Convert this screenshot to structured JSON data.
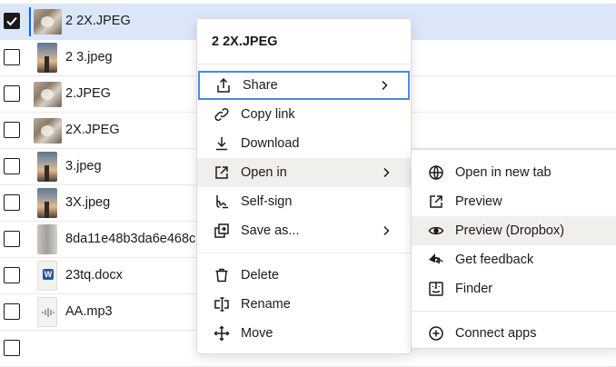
{
  "files": [
    {
      "name": "2 2X.JPEG",
      "thumb": "dog",
      "checked": true,
      "selected": true
    },
    {
      "name": "2 3.jpeg",
      "thumb": "sky",
      "checked": false,
      "selected": false
    },
    {
      "name": "2.JPEG",
      "thumb": "dog",
      "checked": false,
      "selected": false
    },
    {
      "name": "2X.JPEG",
      "thumb": "dog",
      "checked": false,
      "selected": false
    },
    {
      "name": "3.jpeg",
      "thumb": "sky",
      "checked": false,
      "selected": false
    },
    {
      "name": "3X.jpeg",
      "thumb": "sky",
      "checked": false,
      "selected": false
    },
    {
      "name": "8da11e48b3da6e468c",
      "thumb": "gray",
      "checked": false,
      "selected": false
    },
    {
      "name": "23tq.docx",
      "thumb": "doc",
      "checked": false,
      "selected": false
    },
    {
      "name": "AA.mp3",
      "thumb": "audio",
      "checked": false,
      "selected": false
    }
  ],
  "context_menu": {
    "title": "2 2X.JPEG",
    "items": [
      {
        "label": "Share",
        "icon": "share-icon",
        "submenu": true
      },
      {
        "label": "Copy link",
        "icon": "link-icon",
        "submenu": false
      },
      {
        "label": "Download",
        "icon": "download-icon",
        "submenu": false
      },
      {
        "label": "Open in",
        "icon": "open-external-icon",
        "submenu": true
      },
      {
        "label": "Self-sign",
        "icon": "signature-icon",
        "submenu": false
      },
      {
        "label": "Save as...",
        "icon": "save-as-icon",
        "submenu": true
      },
      {
        "label": "Delete",
        "icon": "trash-icon",
        "submenu": false
      },
      {
        "label": "Rename",
        "icon": "rename-icon",
        "submenu": false
      },
      {
        "label": "Move",
        "icon": "move-icon",
        "submenu": false
      }
    ]
  },
  "open_in_submenu": {
    "items": [
      {
        "label": "Open in new tab",
        "icon": "globe-icon"
      },
      {
        "label": "Preview",
        "icon": "open-external-icon"
      },
      {
        "label": "Preview (Dropbox)",
        "icon": "eye-icon"
      },
      {
        "label": "Get feedback",
        "icon": "feedback-icon"
      },
      {
        "label": "Finder",
        "icon": "finder-icon"
      },
      {
        "label": "Connect apps",
        "icon": "plus-circle-icon"
      }
    ]
  },
  "colors": {
    "selected_row": "#dbe7f9",
    "focus_ring": "#4a8ae8",
    "hover": "#f1efec",
    "text": "#1e1919"
  }
}
